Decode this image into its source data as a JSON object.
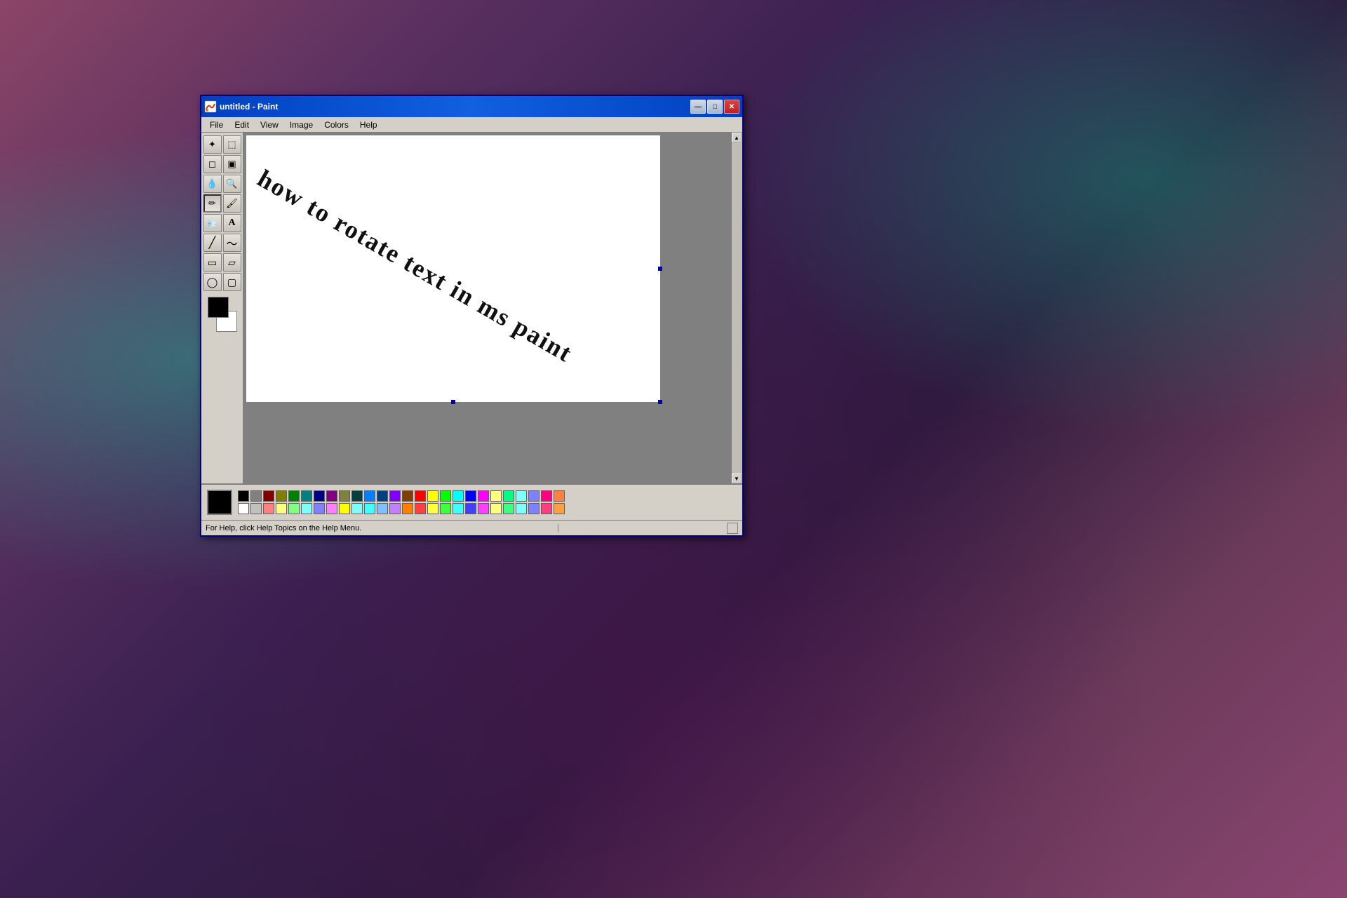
{
  "window": {
    "title": "untitled - Paint",
    "icon": "🖌️"
  },
  "titlebar": {
    "minimize_label": "—",
    "maximize_label": "□",
    "close_label": "✕"
  },
  "menu": {
    "items": [
      "File",
      "Edit",
      "View",
      "Image",
      "Colors",
      "Help"
    ]
  },
  "toolbar": {
    "tools": [
      {
        "icon": "✦",
        "name": "select-irregular"
      },
      {
        "icon": "⬚",
        "name": "select-rect"
      },
      {
        "icon": "⌫",
        "name": "eraser"
      },
      {
        "icon": "🪣",
        "name": "fill"
      },
      {
        "icon": "💧",
        "name": "color-picker"
      },
      {
        "icon": "🔍",
        "name": "magnifier"
      },
      {
        "icon": "✏️",
        "name": "pencil"
      },
      {
        "icon": "🖌",
        "name": "brush"
      },
      {
        "icon": "🖊",
        "name": "pen"
      },
      {
        "icon": "A",
        "name": "text"
      },
      {
        "icon": "╱",
        "name": "line"
      },
      {
        "icon": "〜",
        "name": "curve"
      },
      {
        "icon": "▭",
        "name": "rectangle"
      },
      {
        "icon": "▱",
        "name": "parallelogram"
      },
      {
        "icon": "◯",
        "name": "ellipse"
      },
      {
        "icon": "▢",
        "name": "rounded-rect"
      }
    ]
  },
  "canvas": {
    "text": "how to rotate text in ms paint",
    "bg_color": "white"
  },
  "palette": {
    "selected_color": "#000000",
    "row1": [
      "#000000",
      "#808080",
      "#800000",
      "#808000",
      "#008000",
      "#008080",
      "#000080",
      "#800080",
      "#808040",
      "#004040",
      "#0080ff",
      "#004080",
      "#8000ff",
      "#804000",
      "#ff0000",
      "#ffff00",
      "#00ff00",
      "#00ffff",
      "#0000ff",
      "#ff00ff",
      "#ffff80",
      "#00ff80",
      "#80ffff",
      "#8080ff",
      "#ff0080",
      "#ff8040"
    ],
    "row2": [
      "#ffffff",
      "#c0c0c0",
      "#ff8080",
      "#ffff80",
      "#80ff80",
      "#80ffff",
      "#8080ff",
      "#ff80ff",
      "#ffff00",
      "#80ffff",
      "#40ffff",
      "#80c0ff",
      "#c080ff",
      "#ff8000",
      "#ff4040",
      "#ffff40",
      "#40ff40",
      "#40ffff",
      "#4040ff",
      "#ff40ff",
      "#ffff80",
      "#40ff80",
      "#80ffff",
      "#8080ff",
      "#ff4080",
      "#ffa040"
    ]
  },
  "statusbar": {
    "help_text": "For Help, click Help Topics on the Help Menu.",
    "coords": "",
    "size": ""
  }
}
